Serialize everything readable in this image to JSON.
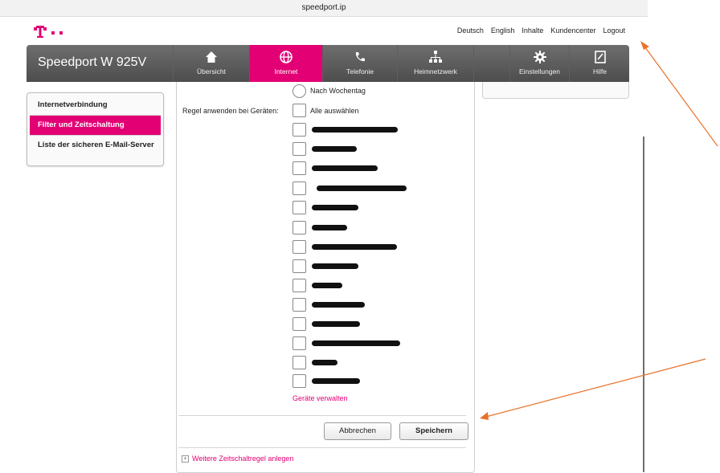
{
  "browser": {
    "url": "speedport.ip"
  },
  "header": {
    "links": [
      "Deutsch",
      "English",
      "Inhalte",
      "Kundencenter",
      "Logout"
    ]
  },
  "navbar": {
    "brand": "Speedport W 925V",
    "items": [
      {
        "label": "Übersicht",
        "icon": "home-icon"
      },
      {
        "label": "Internet",
        "icon": "globe-icon",
        "active": true
      },
      {
        "label": "Telefonie",
        "icon": "phone-icon"
      },
      {
        "label": "Heimnetzwerk",
        "icon": "network-icon"
      },
      {
        "label": "Einstellungen",
        "icon": "gear-icon"
      },
      {
        "label": "Hilfe",
        "icon": "help-icon"
      }
    ],
    "active_color": "#e20074"
  },
  "sidebar": {
    "items": [
      {
        "label": "Internetverbindung"
      },
      {
        "label": "Filter und Zeitschaltung",
        "active": true
      },
      {
        "label": "Liste der sicheren E-Mail-Server"
      }
    ]
  },
  "form": {
    "radio_label": "Nach Wochentag",
    "devices_label": "Regel anwenden bei Geräten:",
    "select_all_label": "Alle auswählen",
    "device_count": 15,
    "manage_devices_link": "Geräte verwalten",
    "cancel_label": "Abbrechen",
    "save_label": "Speichern",
    "add_rule_link": "Weitere Zeitschaltregel anlegen"
  },
  "annotations": {
    "arrow_color": "#e8712a"
  }
}
